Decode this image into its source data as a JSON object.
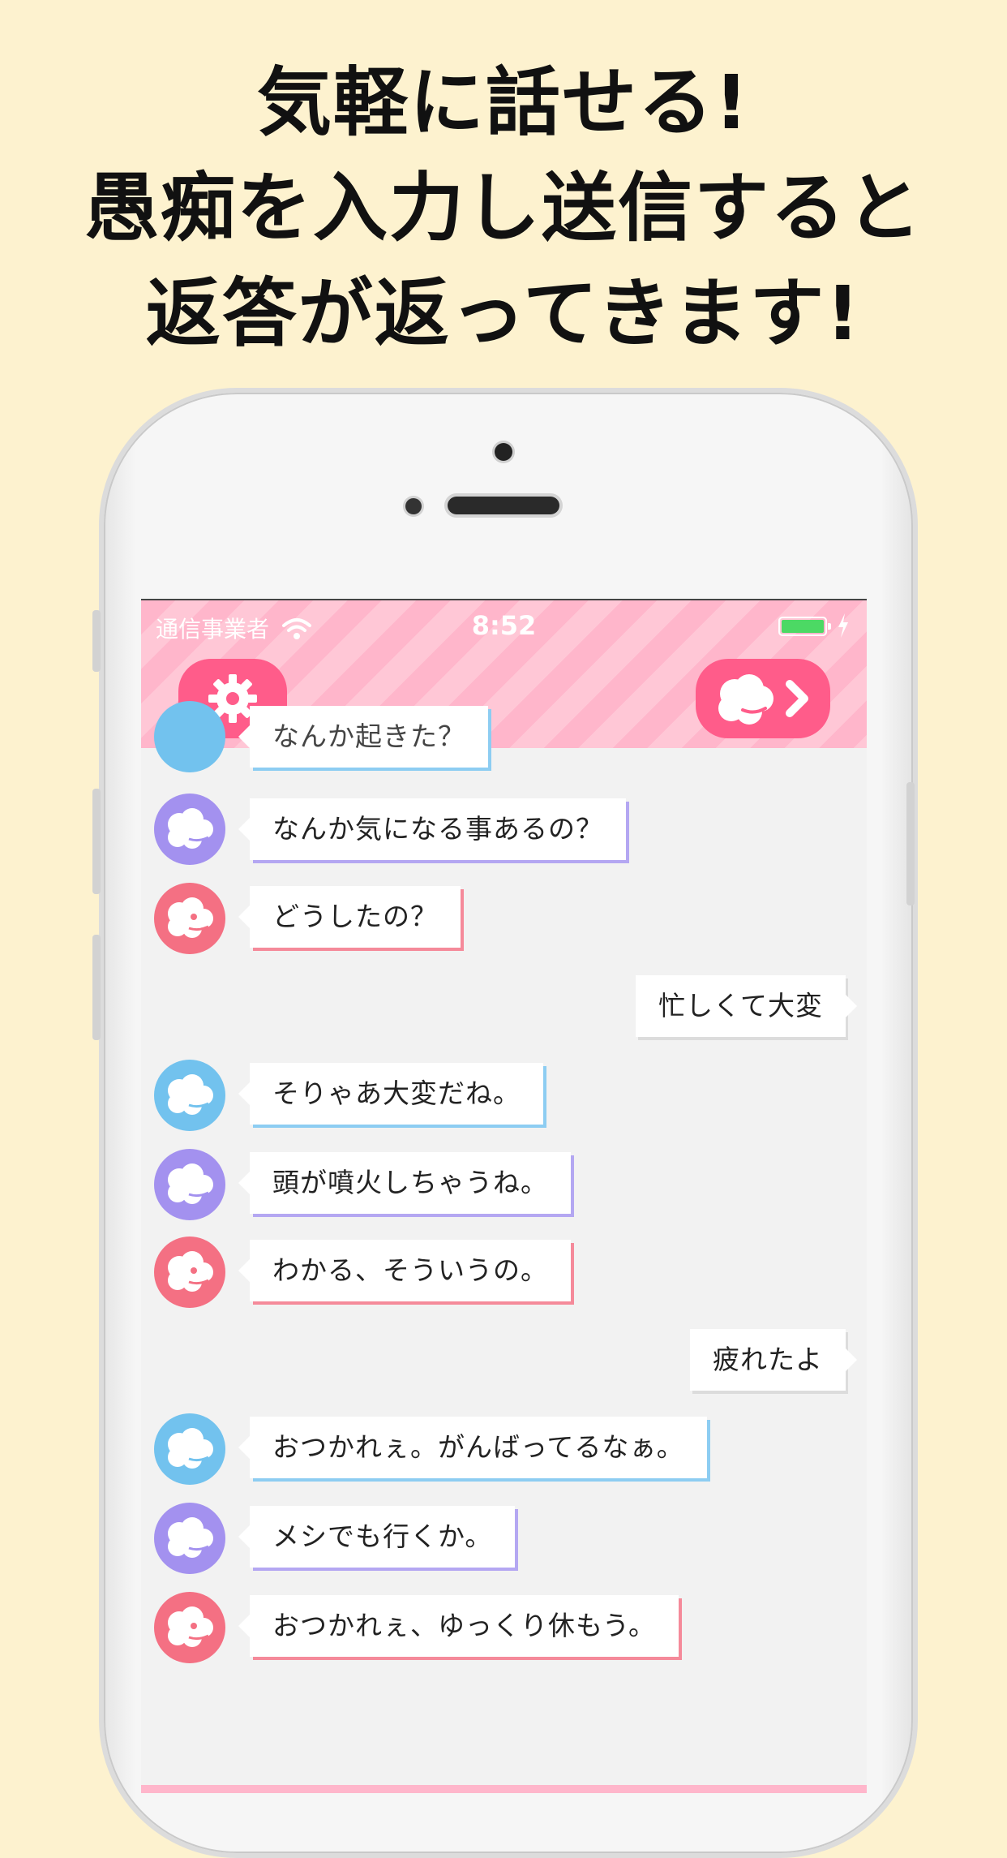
{
  "headline": {
    "line1": "気軽に話せる!",
    "line2": "愚痴を入力し送信すると",
    "line3": "返答が返ってきます!"
  },
  "status_bar": {
    "carrier": "通信事業者",
    "time": "8:52",
    "battery_level": 1.0
  },
  "navbar": {
    "left_icon": "gear-icon",
    "right_icon": "sheep-next-icon"
  },
  "colors": {
    "background": "#fdf2cf",
    "navbar_pink": "#ffb6cb",
    "button_pink": "#ff5c8a",
    "blue_character": "#72c2ee",
    "purple_character": "#a391ef",
    "red_character": "#f47083"
  },
  "chat": {
    "partial_top_text": "なんか起きた？",
    "messages": [
      {
        "side": "left",
        "character": "purple",
        "text": "なんか気になる事あるの？"
      },
      {
        "side": "left",
        "character": "red",
        "text": "どうしたの？"
      },
      {
        "side": "right",
        "text": "忙しくて大変"
      },
      {
        "side": "left",
        "character": "blue",
        "text": "そりゃあ大変だね。"
      },
      {
        "side": "left",
        "character": "purple",
        "text": "頭が噴火しちゃうね。"
      },
      {
        "side": "left",
        "character": "red",
        "text": "わかる、そういうの。"
      },
      {
        "side": "right",
        "text": "疲れたよ"
      },
      {
        "side": "left",
        "character": "blue",
        "text": "おつかれぇ。がんばってるなぁ。"
      },
      {
        "side": "left",
        "character": "purple",
        "text": "メシでも行くか。"
      },
      {
        "side": "left",
        "character": "red",
        "text": "おつかれぇ、ゆっくり休もう。"
      }
    ]
  }
}
